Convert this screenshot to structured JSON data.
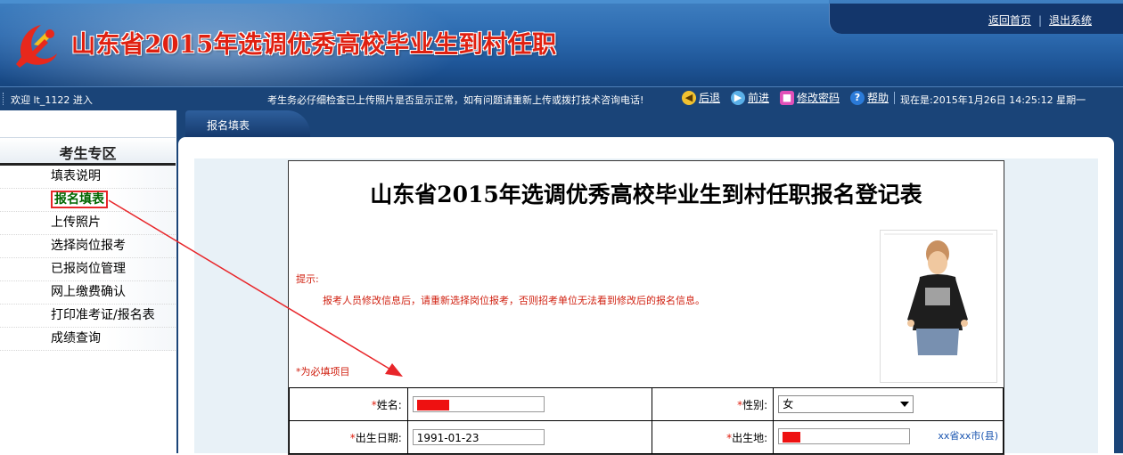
{
  "header": {
    "title": "山东省2015年选调优秀高校毕业生到村任职",
    "links": [
      "返回首页",
      "退出系统"
    ]
  },
  "statusbar": {
    "welcome": "欢迎 lt_1122 进入",
    "notice": "考生务必仔细检查已上传照片是否显示正常，如有问题请重新上传或拨打技术咨询电话!",
    "nav": [
      {
        "label": "后退",
        "icon": "back-arrow-icon"
      },
      {
        "label": "前进",
        "icon": "forward-arrow-icon"
      },
      {
        "label": "修改密码",
        "icon": "lock-icon"
      },
      {
        "label": "帮助",
        "icon": "help-icon"
      }
    ],
    "datetime": "现在是:2015年1月26日  14:25:12 星期一"
  },
  "sidebar": {
    "title": "考生专区",
    "items": [
      "填表说明",
      "报名填表",
      "上传照片",
      "选择岗位报考",
      "已报岗位管理",
      "网上缴费确认",
      "打印准考证/报名表",
      "成绩查询"
    ],
    "active_index": 1
  },
  "main": {
    "tab_label": "报名填表",
    "form": {
      "title": "山东省2015年选调优秀高校毕业生到村任职报名登记表",
      "tip_label": "提示:",
      "tip_text": "报考人员修改信息后，请重新选择岗位报考，否则招考单位无法看到修改后的报名信息。",
      "required_note": "*为必填项目",
      "rows": [
        {
          "left_label": "姓名:",
          "left_value": "",
          "right_label": "性别:",
          "right_value": "女",
          "right_type": "select"
        },
        {
          "left_label": "出生日期:",
          "left_value": "1991-01-23",
          "right_label": "出生地:",
          "right_value": "",
          "right_type": "input",
          "right_hint": "xx省xx市(县)"
        }
      ]
    }
  },
  "colors": {
    "banner_blue": "#2d6bb0",
    "statusbar_bg": "#1a4478",
    "title_red": "#e02010",
    "active_menu_green": "#006600",
    "annotation_red": "#e8262a"
  }
}
